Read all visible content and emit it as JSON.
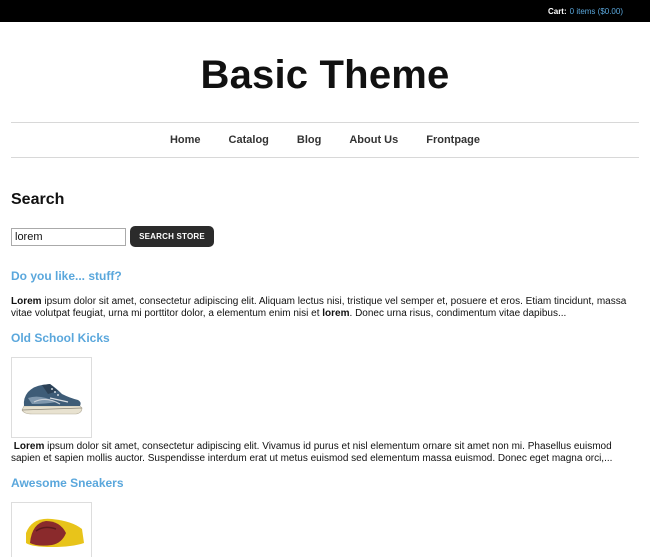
{
  "topbar": {
    "cart_label": "Cart:",
    "cart_link": "0 items ($0.00)"
  },
  "site": {
    "title": "Basic Theme"
  },
  "nav": {
    "items": [
      "Home",
      "Catalog",
      "Blog",
      "About Us",
      "Frontpage"
    ]
  },
  "search": {
    "heading": "Search",
    "query": "lorem",
    "button_label": "SEARCH STORE"
  },
  "results": [
    {
      "title": "Do you like... stuff?",
      "highlight": "Lorem",
      "text_part1": " ipsum dolor sit amet, consectetur adipiscing elit. Aliquam lectus nisi, tristique vel semper et, posuere et eros. Etiam tincidunt, massa vitae volutpat feugiat, urna mi porttitor dolor, a elementum enim nisi et ",
      "highlight2": "lorem",
      "text_part2": ". Donec urna risus, condimentum vitae dapibus..."
    },
    {
      "title": "Old School Kicks",
      "image": "blue-sneaker-image",
      "highlight": "Lorem",
      "text_part1": " ipsum dolor sit amet, consectetur adipiscing elit. Vivamus id purus et nisl elementum ornare sit amet non mi. Phasellus euismod sapien et sapien mollis auctor. Suspendisse interdum erat ut metus euismod sed elementum massa euismod. Donec eget magna orci,..."
    },
    {
      "title": "Awesome Sneakers",
      "image": "red-yellow-sneaker-image"
    }
  ],
  "colors": {
    "topbar_bg": "#000000",
    "link": "#5aa7dc",
    "button_bg": "#2b2b2b"
  }
}
